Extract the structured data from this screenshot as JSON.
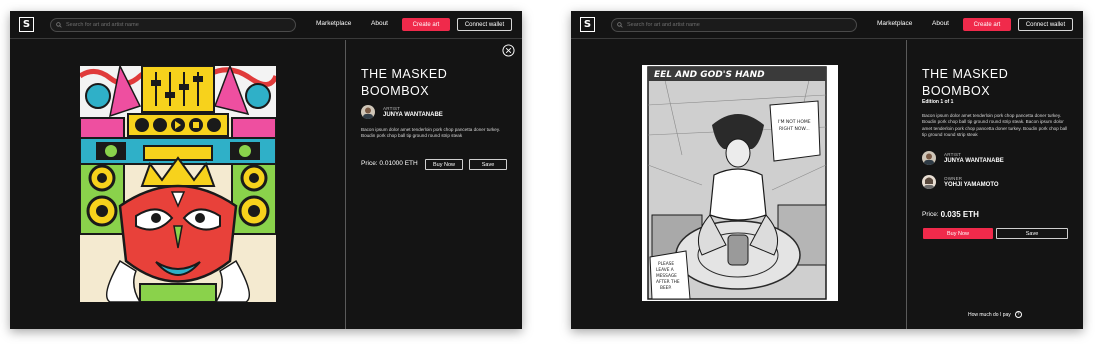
{
  "left_panel": {
    "logo": "S",
    "search_placeholder": "Search for art and artist name",
    "nav": {
      "marketplace": "Marketplace",
      "about": "About",
      "create": "Create art",
      "connect": "Connect wallet"
    },
    "title": "THE MASKED BOOMBOX",
    "artist_role": "ARTIST",
    "artist_name": "JUNYA WANTANABE",
    "description": "Bacon ipsum dolor amet tenderloin pork chop pancetta doner turkey. Boudin pork chop ball tip ground round strip steak",
    "price": "Price: 0.01000 ETH",
    "buy_label": "Buy Now",
    "save_label": "Save",
    "close_icon": "close-circle-icon"
  },
  "right_panel": {
    "logo": "S",
    "search_placeholder": "Search for art and artist name",
    "nav": {
      "marketplace": "Marketplace",
      "about": "About",
      "create": "Create art",
      "connect": "Connect wallet"
    },
    "title": "THE MASKED BOOMBOX",
    "edition": "Edition 1 of 1",
    "description": "Bacon ipsum dolor amet tenderloin pork chop pancetta doner turkey. Boudin pork chop ball tip ground round strip steak. Bacon ipsum dolor amet tenderloin pork chop pancetta doner turkey. Boudin pork chop ball tip ground round strip steak",
    "artist_role": "ARTIST",
    "artist_name": "JUNYA WANTANABE",
    "owner_role": "OWNER",
    "owner_name": "YOHJI YAMAMOTO",
    "price_label": "Price:",
    "price_value": "0.035 ETH",
    "buy_label": "Buy Now",
    "save_label": "Save",
    "help_text": "How much do I pay",
    "help_icon": "question-circle-icon",
    "manga": {
      "title": "EEL AND GOD'S HAND",
      "bubble_top": "I'M NOT HOME RIGHT NOW...",
      "bubble_bottom": "PLEASE LEAVE A MESSAGE AFTER THE BEEP."
    }
  },
  "colors": {
    "accent": "#f02a4b",
    "panel_bg": "#141414",
    "text": "#ffffff"
  }
}
